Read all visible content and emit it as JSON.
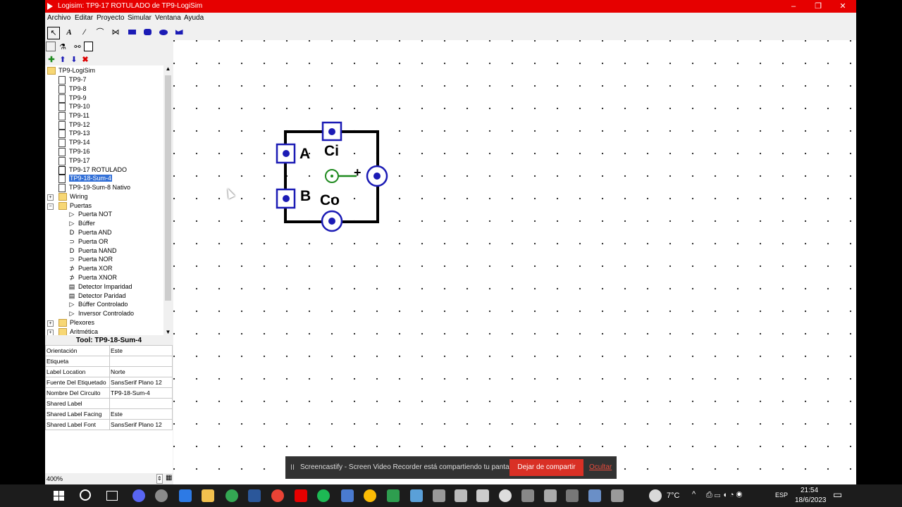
{
  "window": {
    "title": "Logisim: TP9-17 ROTULADO de TP9-LogiSim",
    "min": "–",
    "max": "❐",
    "close": "✕"
  },
  "menu": [
    "Archivo",
    "Editar",
    "Proyecto",
    "Simular",
    "Ventana",
    "Ayuda"
  ],
  "tree": {
    "root": "TP9-LogiSim",
    "circuits": [
      "TP9-7",
      "TP9-8",
      "TP9-9",
      "TP9-10",
      "TP9-11",
      "TP9-12",
      "TP9-13",
      "TP9-14",
      "TP9-16",
      "TP9-17",
      "TP9-17 ROTULADO",
      "TP9-18-Sum-4",
      "TP9-19-Sum-8 Nativo"
    ],
    "selected": "TP9-18-Sum-4",
    "lib_wiring": "Wiring",
    "lib_puertas": "Puertas",
    "gates": [
      "Puerta NOT",
      "Búffer",
      "Puerta AND",
      "Puerta OR",
      "Puerta NAND",
      "Puerta NOR",
      "Puerta XOR",
      "Puerta XNOR",
      "Detector Imparidad",
      "Detector Paridad",
      "Búffer Controlado",
      "Inversor Controlado"
    ],
    "lib_plexores": "Plexores",
    "lib_aritmetica": "Aritmética"
  },
  "props": {
    "header": "Tool: TP9-18-Sum-4",
    "rows": [
      {
        "k": "Orientación",
        "v": "Este"
      },
      {
        "k": "Etiqueta",
        "v": ""
      },
      {
        "k": "Label Location",
        "v": "Norte"
      },
      {
        "k": "Fuente Del Etiquetado",
        "v": "SansSerif Plano 12"
      },
      {
        "k": "Nombre Del Circuito",
        "v": "TP9-18-Sum-4"
      },
      {
        "k": "Shared Label",
        "v": ""
      },
      {
        "k": "Shared Label Facing",
        "v": "Este"
      },
      {
        "k": "Shared Label Font",
        "v": "SansSerif Plano 12"
      }
    ]
  },
  "zoom": "400%",
  "circuit": {
    "labels": {
      "a": "A",
      "b": "B",
      "ci": "Ci",
      "co": "Co",
      "plus": "+"
    }
  },
  "screencast": {
    "pause": "II",
    "message": "Screencastify - Screen Video Recorder está compartiendo tu pantalla.",
    "stop": "Dejar de compartir",
    "hide": "Ocultar"
  },
  "taskbar": {
    "weather": "7°C",
    "lang": "ESP",
    "time": "21:54",
    "date": "18/6/2023"
  },
  "colors": {
    "title_bar": "#e60000",
    "selection": "#3370d7",
    "pin": "#1b1bb5",
    "wire": "#1f8a1f",
    "stop_button": "#d93025"
  }
}
